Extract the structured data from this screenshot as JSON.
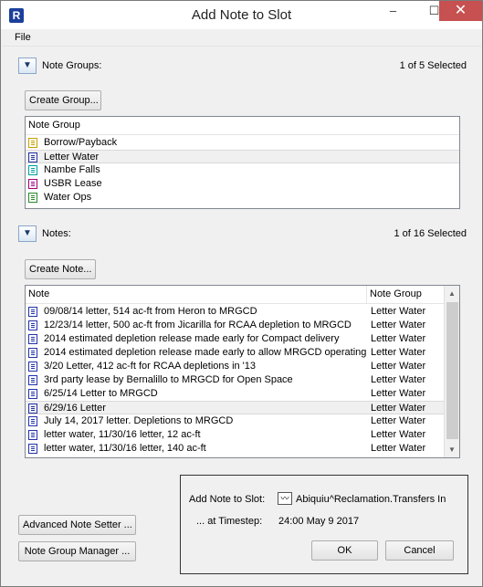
{
  "window": {
    "title": "Add Note to Slot",
    "minimize_glyph": "–",
    "maximize_glyph": "☐",
    "close_glyph": "✕",
    "app_icon_glyph": "R"
  },
  "menu": {
    "file": "File"
  },
  "note_groups": {
    "expander_glyph": "▼",
    "label": "Note Groups:",
    "selection_status": "1 of 5 Selected",
    "create_button": "Create Group...",
    "column_header": "Note Group",
    "sort_glyph": "ˆ",
    "rows": [
      {
        "name": "Borrow/Payback",
        "icon_color": "#c8a000",
        "selected": false
      },
      {
        "name": "Letter Water",
        "icon_color": "#2233aa",
        "selected": true
      },
      {
        "name": "Nambe Falls",
        "icon_color": "#00a0a0",
        "selected": false
      },
      {
        "name": "USBR Lease",
        "icon_color": "#a0007a",
        "selected": false
      },
      {
        "name": "Water Ops",
        "icon_color": "#2a8a2a",
        "selected": false
      }
    ]
  },
  "notes": {
    "expander_glyph": "▼",
    "label": "Notes:",
    "selection_status": "1 of 16 Selected",
    "create_button": "Create Note...",
    "column_note": "Note",
    "column_group": "Note Group",
    "sort_glyph": "ˆ",
    "scroll_up_glyph": "▲",
    "scroll_down_glyph": "▼",
    "rows": [
      {
        "note": "09/08/14 letter, 514 ac-ft from Heron to MRGCD",
        "group": "Letter Water",
        "selected": false
      },
      {
        "note": "12/23/14 letter, 500 ac-ft from Jicarilla for RCAA depletion to MRGCD",
        "group": "Letter Water",
        "selected": false
      },
      {
        "note": "2014 estimated depletion release made early for Compact delivery",
        "group": "Letter Water",
        "selected": false
      },
      {
        "note": "2014 estimated depletion release made early to allow MRGCD operating",
        "group": "Letter Water",
        "selected": false
      },
      {
        "note": "3/20 Letter, 412 ac-ft for RCAA depletions in '13",
        "group": "Letter Water",
        "selected": false
      },
      {
        "note": "3rd party lease by Bernalillo to MRGCD for Open Space",
        "group": "Letter Water",
        "selected": false
      },
      {
        "note": "6/25/14 Letter to MRGCD",
        "group": "Letter Water",
        "selected": false
      },
      {
        "note": "6/29/16 Letter",
        "group": "Letter Water",
        "selected": true
      },
      {
        "note": "July 14, 2017 letter. Depletions to MRGCD",
        "group": "Letter Water",
        "selected": false
      },
      {
        "note": "letter water, 11/30/16 letter, 12 ac-ft",
        "group": "Letter Water",
        "selected": false
      },
      {
        "note": "letter water, 11/30/16 letter, 140 ac-ft",
        "group": "Letter Water",
        "selected": false
      }
    ]
  },
  "add_panel": {
    "slot_label": "Add Note to Slot:",
    "slot_value": "Abiquiu^Reclamation.Transfers In",
    "slot_icon_glyph": "〰",
    "timestep_label": "... at Timestep:",
    "timestep_value": "24:00 May 9 2017",
    "ok_button": "OK",
    "cancel_button": "Cancel"
  },
  "buttons": {
    "advanced_setter": "Advanced Note Setter ...",
    "group_manager": "Note Group Manager ..."
  },
  "colors": {
    "letter_water_icon": "#2233aa",
    "close_button": "#c75050",
    "app_icon": "#1c3f9c"
  }
}
